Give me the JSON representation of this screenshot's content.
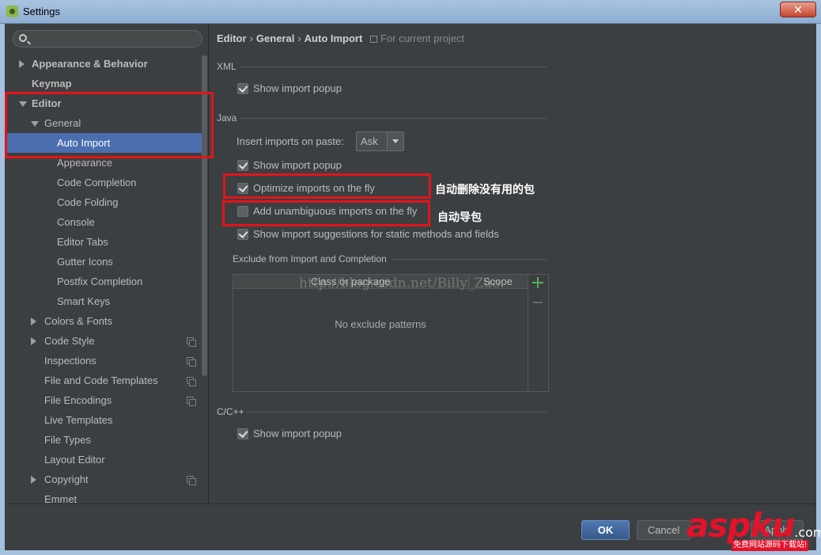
{
  "window": {
    "title": "Settings",
    "close_label": "✕"
  },
  "search": {
    "placeholder": ""
  },
  "sidebar": {
    "items": [
      {
        "label": "Appearance & Behavior",
        "level": 0,
        "bold": true,
        "arrow": "right"
      },
      {
        "label": "Keymap",
        "level": 0,
        "bold": true,
        "arrow": "none"
      },
      {
        "label": "Editor",
        "level": 0,
        "bold": true,
        "arrow": "down"
      },
      {
        "label": "General",
        "level": 1,
        "bold": false,
        "arrow": "down"
      },
      {
        "label": "Auto Import",
        "level": 2,
        "bold": false,
        "arrow": "none",
        "selected": true
      },
      {
        "label": "Appearance",
        "level": 2,
        "bold": false,
        "arrow": "none"
      },
      {
        "label": "Code Completion",
        "level": 2,
        "bold": false,
        "arrow": "none"
      },
      {
        "label": "Code Folding",
        "level": 2,
        "bold": false,
        "arrow": "none"
      },
      {
        "label": "Console",
        "level": 2,
        "bold": false,
        "arrow": "none"
      },
      {
        "label": "Editor Tabs",
        "level": 2,
        "bold": false,
        "arrow": "none"
      },
      {
        "label": "Gutter Icons",
        "level": 2,
        "bold": false,
        "arrow": "none"
      },
      {
        "label": "Postfix Completion",
        "level": 2,
        "bold": false,
        "arrow": "none"
      },
      {
        "label": "Smart Keys",
        "level": 2,
        "bold": false,
        "arrow": "none"
      },
      {
        "label": "Colors & Fonts",
        "level": 1,
        "bold": false,
        "arrow": "right"
      },
      {
        "label": "Code Style",
        "level": 1,
        "bold": false,
        "arrow": "right",
        "project": true
      },
      {
        "label": "Inspections",
        "level": 1,
        "bold": false,
        "arrow": "none",
        "project": true
      },
      {
        "label": "File and Code Templates",
        "level": 1,
        "bold": false,
        "arrow": "none",
        "project": true
      },
      {
        "label": "File Encodings",
        "level": 1,
        "bold": false,
        "arrow": "none",
        "project": true
      },
      {
        "label": "Live Templates",
        "level": 1,
        "bold": false,
        "arrow": "none"
      },
      {
        "label": "File Types",
        "level": 1,
        "bold": false,
        "arrow": "none"
      },
      {
        "label": "Layout Editor",
        "level": 1,
        "bold": false,
        "arrow": "none"
      },
      {
        "label": "Copyright",
        "level": 1,
        "bold": false,
        "arrow": "right",
        "project": true
      },
      {
        "label": "Emmet",
        "level": 1,
        "bold": false,
        "arrow": "none"
      }
    ]
  },
  "breadcrumb": {
    "part1": "Editor",
    "part2": "General",
    "part3": "Auto Import",
    "scope": "For current project"
  },
  "xml": {
    "title": "XML",
    "show_popup": {
      "label": "Show import popup",
      "checked": true
    }
  },
  "java": {
    "title": "Java",
    "paste_label": "Insert imports on paste:",
    "paste_value": "Ask",
    "show_popup": {
      "label": "Show import popup",
      "checked": true
    },
    "optimize": {
      "label": "Optimize imports on the fly",
      "checked": true
    },
    "unambiguous": {
      "label": "Add unambiguous imports on the fly",
      "checked": false
    },
    "static_suggestions": {
      "label": "Show import suggestions for static methods and fields",
      "checked": true
    }
  },
  "exclude": {
    "title": "Exclude from Import and Completion",
    "col_class": "Class or package",
    "col_scope": "Scope",
    "empty": "No exclude patterns"
  },
  "cpp": {
    "title": "C/C++",
    "show_popup": {
      "label": "Show import popup",
      "checked": true
    }
  },
  "annotations": {
    "optimize_note": "自动删除没有用的包",
    "unambiguous_note": "自动导包"
  },
  "watermark": "http://blog.csdn.net/Billy_Zuo",
  "buttons": {
    "ok": "OK",
    "cancel": "Cancel",
    "apply": "Apply"
  },
  "logo": {
    "brand": "aspku",
    "suffix": ".com",
    "tagline": "免费网站源码下载站!"
  },
  "colors": {
    "selection": "#4b6eaf",
    "annotation_border": "#e0141b",
    "ok_button": "#4e79b2",
    "logo_red": "#e4122a"
  }
}
